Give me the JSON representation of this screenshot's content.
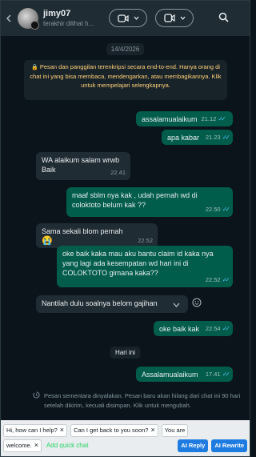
{
  "header": {
    "contact_name": "jimy07",
    "last_seen": "terakhir dilihat h...",
    "video_icon": "video-call-icon",
    "call_icon": "voice-call-icon",
    "search_icon": "search-icon"
  },
  "chat": {
    "date": "14/4/2026",
    "encryption_notice": "Pesan dan panggilan terenkripsi secara end-to-end. Hanya orang di chat ini yang bisa membaca, mendengarkan, atau membagikannya. Klik untuk mempelajari selengkapnya.",
    "messages": [
      {
        "dir": "out",
        "text": "assalamualaikum",
        "time": "21.12"
      },
      {
        "dir": "out",
        "text": "apa kabar",
        "time": "21.23"
      },
      {
        "dir": "in",
        "text": "WA  alaikum salam wrwb\nBaik",
        "time": "22.41"
      },
      {
        "dir": "out",
        "text": "maaf sblm nya kak , udah pernah wd di coloktoto belum kak ??",
        "time": "22.50"
      },
      {
        "dir": "in",
        "text": "Sama sekali blom pernah",
        "emoji": "😭",
        "time": "22.52"
      },
      {
        "dir": "out",
        "text": "oke baik kaka mau aku bantu claim id kaka nya yang lagi ada kesempatan wd hari ini di COLOKTOTO gimana kaka??",
        "time": "22.52"
      },
      {
        "dir": "in",
        "text": "Nantilah dulu soalnya belom gajihan"
      },
      {
        "dir": "out",
        "text": "oke baik kak",
        "time": "22.54"
      },
      {
        "dir": "out",
        "text": "Assalamualaikum",
        "time": "17.41"
      }
    ],
    "day_separator": "Hari ini",
    "ephemeral_notice": "Pesan sementara dinyalakan. Pesan baru akan hilang dari chat ini 90 hari setelah dikirim, kecuali disimpan. Klik untuk mengubah."
  },
  "quick_chat": {
    "chips": [
      "Hi, how can I help?",
      "Can I get back to you soon?",
      "You are",
      "welcome."
    ],
    "add_label": "Add quick chat",
    "ai_reply_label": "AI Reply",
    "ai_rewrite_label": "AI Rewrite"
  },
  "colors": {
    "background": "#0b141a",
    "outgoing_bubble": "#005c4b",
    "incoming_bubble": "#202c33",
    "header": "#202c33",
    "read_ticks": "#53bdeb",
    "notice_text": "#ffd279",
    "accent_blue": "#1e7be0"
  }
}
